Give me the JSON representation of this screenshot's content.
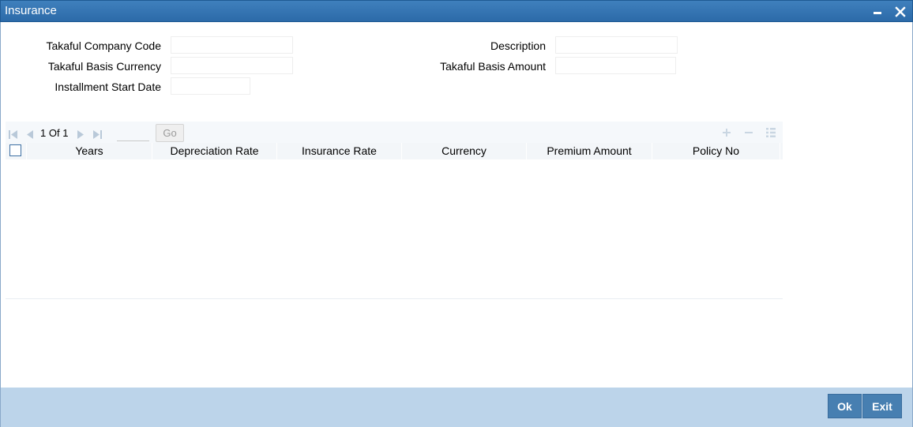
{
  "window": {
    "title": "Insurance"
  },
  "form": {
    "takaful_company_code": {
      "label": "Takaful Company Code",
      "value": ""
    },
    "takaful_basis_currency": {
      "label": "Takaful Basis Currency",
      "value": ""
    },
    "installment_start_date": {
      "label": "Installment Start Date",
      "value": ""
    },
    "description": {
      "label": "Description",
      "value": ""
    },
    "takaful_basis_amount": {
      "label": "Takaful Basis Amount",
      "value": ""
    }
  },
  "grid": {
    "pager": {
      "current": "1",
      "of_label": "Of",
      "total": "1",
      "page_input": "",
      "go_label": "Go"
    },
    "columns": [
      "Years",
      "Depreciation Rate",
      "Insurance Rate",
      "Currency",
      "Premium Amount",
      "Policy No"
    ],
    "rows": []
  },
  "footer": {
    "ok_label": "Ok",
    "exit_label": "Exit"
  },
  "colors": {
    "titlebar": "#2c6aa8",
    "footer": "#bcd4ea",
    "button": "#477fb1"
  }
}
